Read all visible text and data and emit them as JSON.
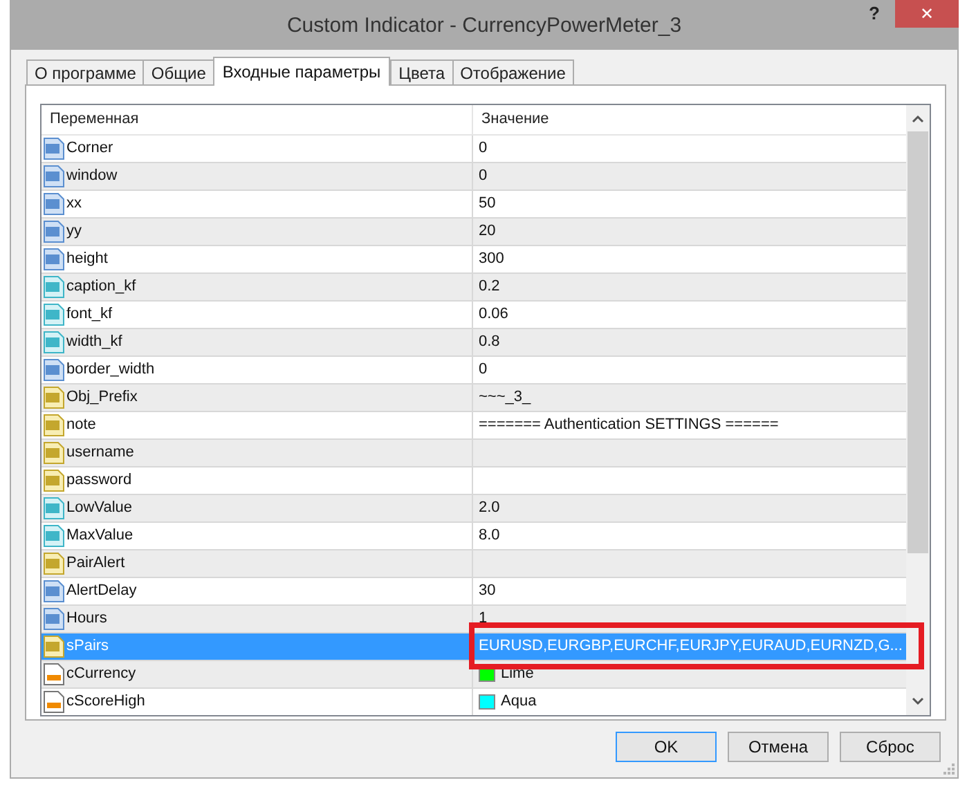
{
  "window": {
    "title": "Custom Indicator - CurrencyPowerMeter_3",
    "help": "?",
    "close": "✕"
  },
  "tabs": [
    {
      "label": "О программе",
      "selected": false
    },
    {
      "label": "Общие",
      "selected": false
    },
    {
      "label": "Входные параметры",
      "selected": true
    },
    {
      "label": "Цвета",
      "selected": false
    },
    {
      "label": "Отображение",
      "selected": false
    }
  ],
  "table": {
    "columns": [
      "Переменная",
      "Значение"
    ],
    "rows": [
      {
        "kind": "int",
        "name": "Corner",
        "value": "0",
        "selected": false,
        "highlighted": false
      },
      {
        "kind": "int",
        "name": "window",
        "value": "0",
        "selected": false,
        "highlighted": false
      },
      {
        "kind": "int",
        "name": "xx",
        "value": "50",
        "selected": false,
        "highlighted": false
      },
      {
        "kind": "int",
        "name": "yy",
        "value": "20",
        "selected": false,
        "highlighted": false
      },
      {
        "kind": "int",
        "name": "height",
        "value": "300",
        "selected": false,
        "highlighted": false
      },
      {
        "kind": "double",
        "name": "caption_kf",
        "value": "0.2",
        "selected": false,
        "highlighted": false
      },
      {
        "kind": "double",
        "name": "font_kf",
        "value": "0.06",
        "selected": false,
        "highlighted": false
      },
      {
        "kind": "double",
        "name": "width_kf",
        "value": "0.8",
        "selected": false,
        "highlighted": false
      },
      {
        "kind": "int",
        "name": "border_width",
        "value": "0",
        "selected": false,
        "highlighted": false
      },
      {
        "kind": "string",
        "name": "Obj_Prefix",
        "value": "~~~_3_",
        "selected": false,
        "highlighted": false
      },
      {
        "kind": "string",
        "name": "note",
        "value": "======= Authentication SETTINGS ======",
        "selected": false,
        "highlighted": false
      },
      {
        "kind": "string",
        "name": "username",
        "selected": false,
        "highlighted": false
      },
      {
        "kind": "string",
        "name": "password",
        "selected": false,
        "highlighted": false
      },
      {
        "kind": "double",
        "name": "LowValue",
        "value": "2.0",
        "selected": false,
        "highlighted": false
      },
      {
        "kind": "double",
        "name": "MaxValue",
        "value": "8.0",
        "selected": false,
        "highlighted": false
      },
      {
        "kind": "string",
        "name": "PairAlert",
        "selected": false,
        "highlighted": false
      },
      {
        "kind": "int",
        "name": "AlertDelay",
        "value": "30",
        "selected": false,
        "highlighted": false
      },
      {
        "kind": "int",
        "name": "Hours",
        "value": "1",
        "selected": false,
        "highlighted": false
      },
      {
        "kind": "string",
        "name": "sPairs",
        "value": "EURUSD,EURGBP,EURCHF,EURJPY,EURAUD,EURNZD,G...",
        "selected": true,
        "highlighted": true
      },
      {
        "kind": "color",
        "name": "cCurrency",
        "value": "Lime",
        "color": "#00ff00",
        "selected": false,
        "highlighted": false
      },
      {
        "kind": "color",
        "name": "cScoreHigh",
        "value": "Aqua",
        "color": "#00ffff",
        "selected": false,
        "highlighted": false
      }
    ]
  },
  "buttons": [
    {
      "label": "OK",
      "default": true
    },
    {
      "label": "Отмена",
      "default": false
    },
    {
      "label": "Сброс",
      "default": false
    }
  ]
}
